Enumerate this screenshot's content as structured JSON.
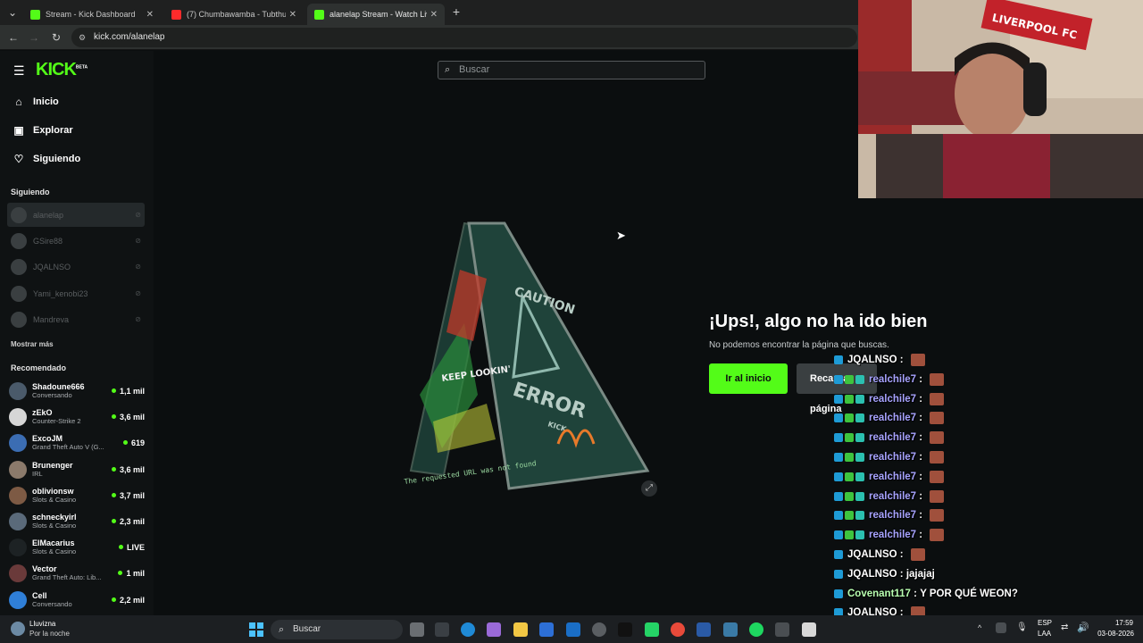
{
  "browser": {
    "tabs": [
      {
        "title": "Stream - Kick Dashboard",
        "active": false
      },
      {
        "title": "(7) Chumbawamba - Tubthump",
        "active": false
      },
      {
        "title": "alanelap Stream - Watch Live o",
        "active": true
      }
    ],
    "url": "kick.com/alanelap"
  },
  "sidebar": {
    "nav": [
      {
        "label": "Inicio",
        "icon": "home-icon"
      },
      {
        "label": "Explorar",
        "icon": "compass-icon"
      },
      {
        "label": "Siguiendo",
        "icon": "heart-icon"
      }
    ],
    "following_heading": "Siguiendo",
    "following": [
      "alanelap",
      "GSire88",
      "JQALNSO",
      "Yami_kenobi23",
      "Mandreva"
    ],
    "show_more": "Mostrar más",
    "recommended_heading": "Recomendado",
    "recommended": [
      {
        "name": "Shadoune666",
        "category": "Conversando",
        "viewers": "1,1 mil"
      },
      {
        "name": "zEkO",
        "category": "Counter-Strike 2",
        "viewers": "3,6 mil"
      },
      {
        "name": "ExcoJM",
        "category": "Grand Theft Auto V (G...",
        "viewers": "619"
      },
      {
        "name": "Brunenger",
        "category": "IRL",
        "viewers": "3,6 mil"
      },
      {
        "name": "oblivionsw",
        "category": "Slots & Casino",
        "viewers": "3,7 mil"
      },
      {
        "name": "schneckyirl",
        "category": "Slots & Casino",
        "viewers": "2,3 mil"
      },
      {
        "name": "ElMacarius",
        "category": "Slots & Casino",
        "viewers": "LIVE"
      },
      {
        "name": "Vector",
        "category": "Grand Theft Auto: Lib...",
        "viewers": "1 mil"
      },
      {
        "name": "Cell",
        "category": "Conversando",
        "viewers": "2,2 mil"
      }
    ]
  },
  "header": {
    "logo": "KICK",
    "logo_badge": "BETA",
    "search_placeholder": "Buscar"
  },
  "error": {
    "title": "¡Ups!, algo no ha ido bien",
    "subtitle": "No podemos encontrar la página que buscas.",
    "home_button": "Ir al inicio",
    "reload_button": "Recargar página",
    "sign": {
      "caution": "CAUTION",
      "error": "ERROR",
      "brand": "KICK",
      "side_text": "KEEP LOOKIN'",
      "bottom_text": "The requested URL was not found"
    }
  },
  "chat": [
    {
      "user": "JQALNSO",
      "text": "",
      "color": "#ffffff",
      "emote": true
    },
    {
      "user": "realchile7",
      "text": "",
      "color": "#a7a3ff",
      "emote": true
    },
    {
      "user": "realchile7",
      "text": "",
      "color": "#a7a3ff",
      "emote": true
    },
    {
      "user": "realchile7",
      "text": "",
      "color": "#a7a3ff",
      "emote": true
    },
    {
      "user": "realchile7",
      "text": "",
      "color": "#a7a3ff",
      "emote": true
    },
    {
      "user": "realchile7",
      "text": "",
      "color": "#a7a3ff",
      "emote": true
    },
    {
      "user": "realchile7",
      "text": "",
      "color": "#a7a3ff",
      "emote": true
    },
    {
      "user": "realchile7",
      "text": "",
      "color": "#a7a3ff",
      "emote": true
    },
    {
      "user": "realchile7",
      "text": "",
      "color": "#a7a3ff",
      "emote": true
    },
    {
      "user": "realchile7",
      "text": "",
      "color": "#a7a3ff",
      "emote": true
    },
    {
      "user": "JQALNSO",
      "text": "",
      "color": "#ffffff",
      "emote": true
    },
    {
      "user": "JQALNSO",
      "text": "jajajaj",
      "color": "#ffffff",
      "emote": false
    },
    {
      "user": "Covenant117",
      "text": "Y POR QUÉ WEON?",
      "color": "#b8ffb0",
      "emote": false
    },
    {
      "user": "JQALNSO",
      "text": "",
      "color": "#ffffff",
      "emote": true
    }
  ],
  "webcam": {
    "banner": "LIVERPOOL FC"
  },
  "taskbar": {
    "weather_title": "Lluvizna",
    "weather_sub": "Por la noche",
    "search": "Buscar",
    "lang": "ESP",
    "lang_sub": "LAA",
    "time": "17:59",
    "date": "03-08-2026"
  },
  "colors": {
    "kick_green": "#53fc18",
    "bg": "#0b0e0f",
    "sidebar": "#0f1213"
  }
}
